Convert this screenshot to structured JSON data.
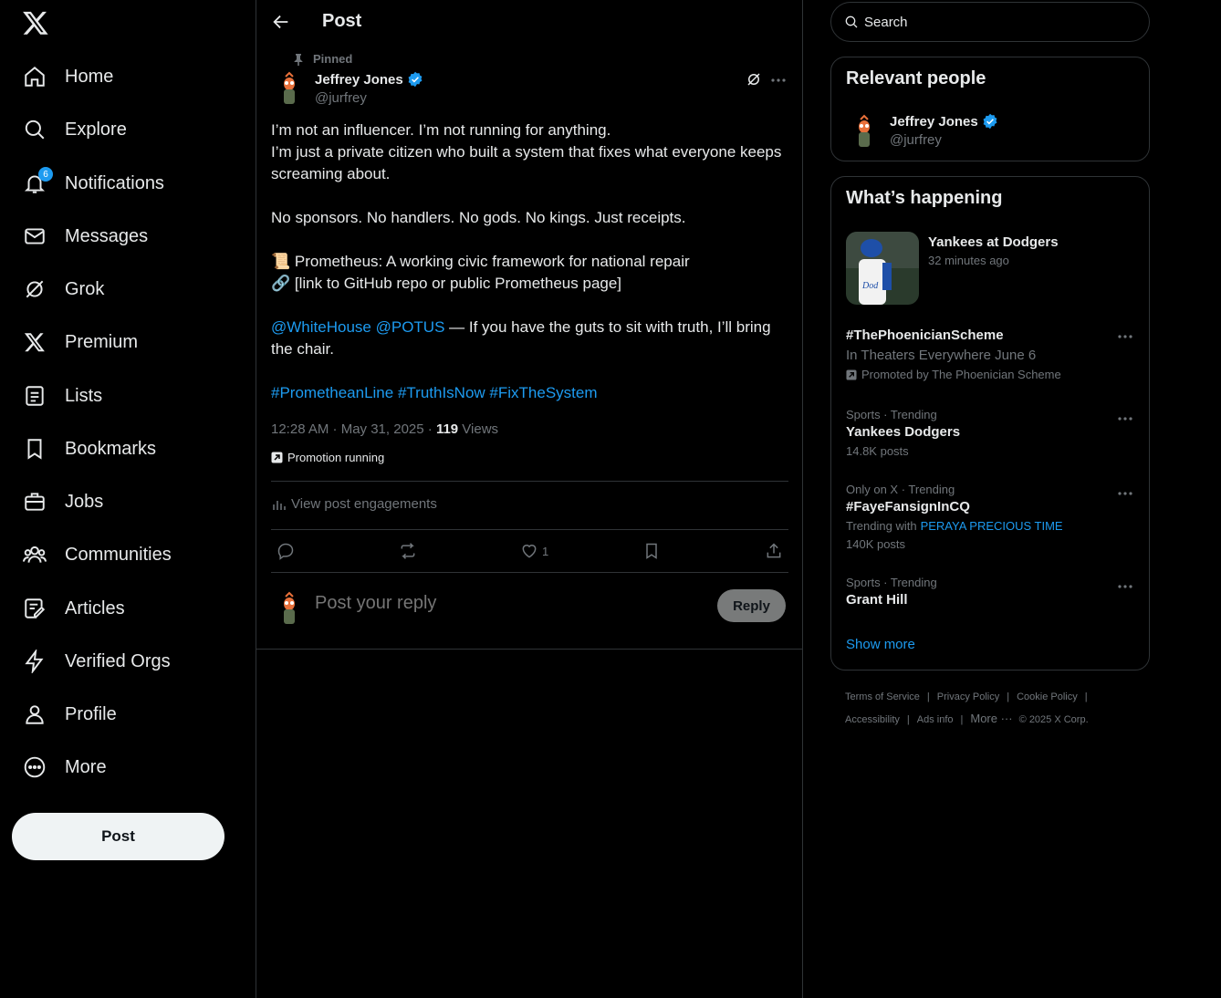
{
  "nav": {
    "items": [
      {
        "label": "Home",
        "icon": "home-icon"
      },
      {
        "label": "Explore",
        "icon": "search-icon"
      },
      {
        "label": "Notifications",
        "icon": "bell-icon",
        "badge": "6"
      },
      {
        "label": "Messages",
        "icon": "envelope-icon"
      },
      {
        "label": "Grok",
        "icon": "grok-icon"
      },
      {
        "label": "Premium",
        "icon": "x-logo-icon"
      },
      {
        "label": "Lists",
        "icon": "list-icon"
      },
      {
        "label": "Bookmarks",
        "icon": "bookmark-icon"
      },
      {
        "label": "Jobs",
        "icon": "briefcase-icon"
      },
      {
        "label": "Communities",
        "icon": "people-icon"
      },
      {
        "label": "Articles",
        "icon": "article-icon"
      },
      {
        "label": "Verified Orgs",
        "icon": "lightning-icon"
      },
      {
        "label": "Profile",
        "icon": "person-icon"
      },
      {
        "label": "More",
        "icon": "more-circle-icon"
      }
    ],
    "post_label": "Post"
  },
  "main": {
    "title": "Post",
    "pinned_label": "Pinned",
    "author": {
      "name": "Jeffrey Jones",
      "handle": "@jurfrey"
    },
    "body": {
      "line1": "I’m not an influencer. I’m not running for anything.",
      "line2": "I’m just a private citizen who built a system that fixes what everyone keeps screaming about.",
      "line3": "No sponsors. No handlers. No gods. No kings. Just receipts.",
      "line4": "📜 Prometheus: A working civic framework for national repair",
      "line5": "🔗 [link to GitHub repo or public Prometheus page]",
      "mention1": "@WhiteHouse",
      "mention2": "@POTUS",
      "line6_rest": " — If you have the guts to sit with truth, I’ll bring the chair.",
      "hashtag1": "#PrometheanLine",
      "hashtag2": "#TruthIsNow",
      "hashtag3": "#FixTheSystem"
    },
    "timestamp": "12:28 AM · May 31, 2025 · ",
    "views_count": "119",
    "views_label": " Views",
    "promotion": "Promotion running",
    "engagements_label": "View post engagements",
    "like_count": "1",
    "reply_placeholder": "Post your reply",
    "reply_button": "Reply"
  },
  "right": {
    "search_placeholder": "Search",
    "relevant": {
      "title": "Relevant people",
      "name": "Jeffrey Jones",
      "handle": "@jurfrey"
    },
    "happening": {
      "title": "What’s happening",
      "event_title": "Yankees at Dodgers",
      "event_time": "32 minutes ago",
      "trends": [
        {
          "title": "#ThePhoenicianScheme",
          "sub": "In Theaters Everywhere June 6",
          "promo": "Promoted by The Phoenician Scheme"
        },
        {
          "context": "Sports · Trending",
          "title": "Yankees Dodgers",
          "posts": "14.8K posts"
        },
        {
          "context": "Only on X · Trending",
          "title": "#FayeFansignInCQ",
          "with_label": "Trending with",
          "with_link": "PERAYA PRECIOUS TIME",
          "posts": "140K posts"
        },
        {
          "context": "Sports · Trending",
          "title": "Grant Hill"
        }
      ],
      "show_more": "Show more"
    },
    "footer": {
      "terms": "Terms of Service",
      "privacy": "Privacy Policy",
      "cookie": "Cookie Policy",
      "accessibility": "Accessibility",
      "ads": "Ads info",
      "more": "More ···",
      "copyright": "© 2025 X Corp."
    }
  },
  "colors": {
    "accent": "#1d9bf0",
    "background": "#000000",
    "border": "#2f3336",
    "muted": "#71767b",
    "text": "#e7e9ea"
  }
}
